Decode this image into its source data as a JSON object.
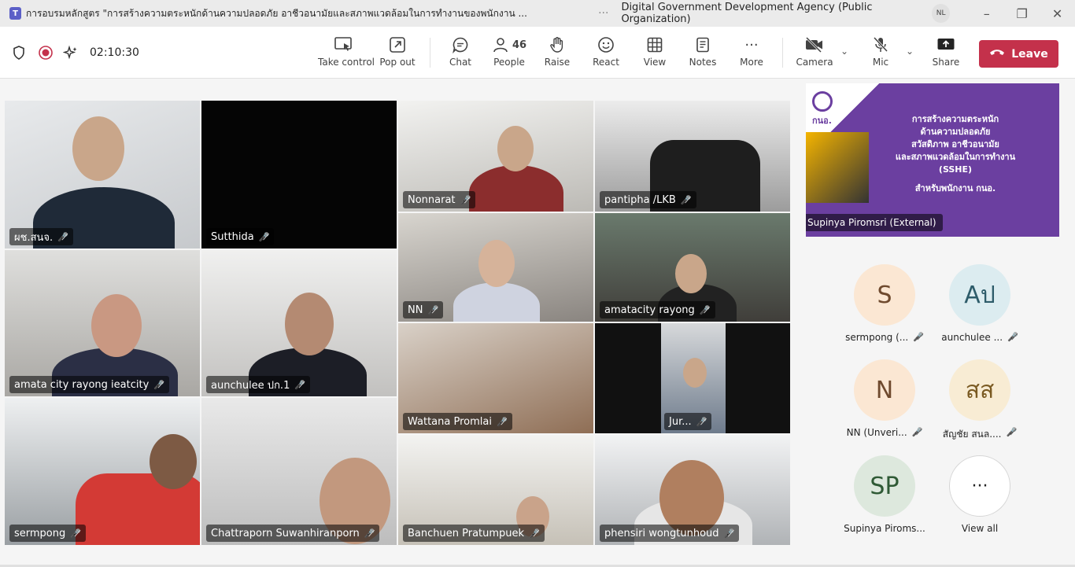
{
  "titlebar": {
    "app_icon": "teams-icon",
    "title": "การอบรมหลักสูตร \"การสร้างความตระหนักด้านความปลอดภัย อาชีวอนามัยและสภาพแวดล้อมในการทำงานของพนักงาน ...",
    "more": "···",
    "org": "Digital Government Development Agency (Public Organization)",
    "avatar": "NL",
    "minimize": "–",
    "restore": "❐",
    "close": "✕"
  },
  "toolbar": {
    "timer": "02:10:30",
    "take_control": "Take control",
    "pop_out": "Pop out",
    "chat": "Chat",
    "people": "People",
    "people_count": "46",
    "raise": "Raise",
    "react": "React",
    "view": "View",
    "notes": "Notes",
    "more": "More",
    "camera": "Camera",
    "mic": "Mic",
    "share": "Share",
    "leave": "Leave"
  },
  "tiles": [
    {
      "name": "ผช.สนจ."
    },
    {
      "name": "Sutthida"
    },
    {
      "name": "Nonnarat"
    },
    {
      "name": "pantipha /LKB"
    },
    {
      "name": "NN"
    },
    {
      "name": "amatacity rayong"
    },
    {
      "name": "amata city rayong ieatcity"
    },
    {
      "name": "aunchulee ปก.1"
    },
    {
      "name": "Wattana Promlai"
    },
    {
      "name": "Jur..."
    },
    {
      "name": "sermpong"
    },
    {
      "name": "Chattraporn Suwanhiranporn"
    },
    {
      "name": "Banchuen Pratumpuek"
    },
    {
      "name": "phensiri wongtunhoud"
    }
  ],
  "presentation": {
    "presenter": "Supinya Piromsri (External)",
    "logo_text": "กนอ.",
    "line1": "การสร้างความตระหนัก",
    "line2": "ด้านความปลอดภัย",
    "line3": "สวัสดิภาพ อาชีวอนามัย",
    "line4": "และสภาพแวดล้อมในการทำงาน",
    "line5": "(SSHE)",
    "line6": "สำหรับพนักงาน กนอ."
  },
  "participants": [
    {
      "initials": "S",
      "name": "sermpong (...",
      "bg": "#fbe7d3"
    },
    {
      "initials": "Aป",
      "name": "aunchulee ...",
      "bg": "#dcecf0"
    },
    {
      "initials": "N",
      "name": "NN (Unveri...",
      "bg": "#fbe7d3"
    },
    {
      "initials": "สส",
      "name": "สัญชัย สนล....",
      "bg": "#f8ecd4"
    },
    {
      "initials": "SP",
      "name": "Supinya Piroms...",
      "bg": "#dde8dd"
    },
    {
      "initials": "···",
      "name": "View all",
      "bg": "#ffffff"
    }
  ],
  "colors": {
    "accent": "#5b5fc7",
    "leave": "#c4314b"
  }
}
